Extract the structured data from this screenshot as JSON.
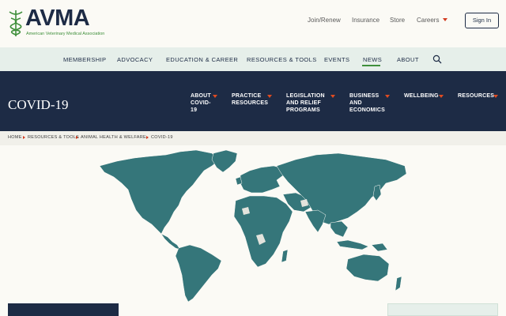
{
  "brand": {
    "logo_text": "AVMA",
    "logo_subtitle": "American Veterinary Medical Association",
    "colors": {
      "navy": "#1d2b45",
      "green": "#3f8f3b",
      "accent": "#e04b21",
      "map_fill": "#35767a"
    }
  },
  "utility_nav": {
    "join": "Join/Renew",
    "insurance": "Insurance",
    "store": "Store",
    "careers": "Careers",
    "sign_in": "Sign In"
  },
  "main_nav": {
    "items": [
      "MEMBERSHIP",
      "ADVOCACY",
      "EDUCATION & CAREER",
      "RESOURCES & TOOLS",
      "EVENTS",
      "NEWS",
      "ABOUT"
    ],
    "active": "NEWS",
    "search_icon": "search-icon"
  },
  "hero": {
    "title": "COVID-19",
    "menu": [
      {
        "line1": "ABOUT",
        "line2": "COVID-",
        "line3": "19"
      },
      {
        "line1": "PRACTICE",
        "line2": "RESOURCES",
        "line3": ""
      },
      {
        "line1": "LEGISLATION",
        "line2": "AND RELIEF",
        "line3": "PROGRAMS"
      },
      {
        "line1": "BUSINESS",
        "line2": "AND",
        "line3": "ECONOMICS"
      },
      {
        "line1": "WELLBEING",
        "line2": "",
        "line3": ""
      },
      {
        "line1": "RESOURCES",
        "line2": "",
        "line3": ""
      }
    ]
  },
  "breadcrumb": [
    "HOME",
    "RESOURCES & TOOLS",
    "ANIMAL HEALTH & WELFARE",
    "COVID-19"
  ],
  "map": {
    "icon": "world-map"
  }
}
